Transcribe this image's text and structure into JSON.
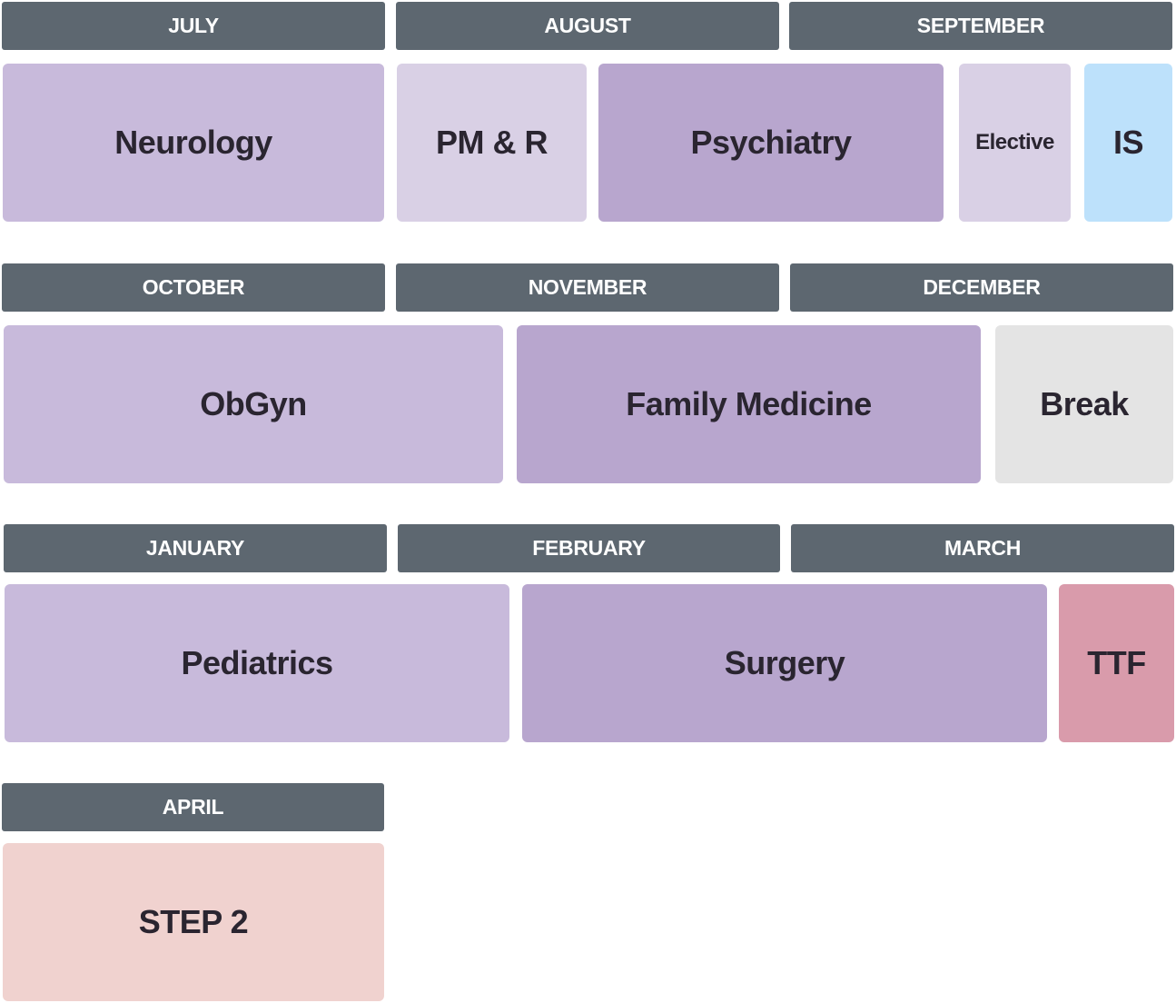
{
  "rows": [
    {
      "months": [
        "JULY",
        "AUGUST",
        "SEPTEMBER"
      ],
      "rotations": [
        {
          "label": "Neurology",
          "color": "#c8badb"
        },
        {
          "label": "PM & R",
          "color": "#d9d0e5"
        },
        {
          "label": "Psychiatry",
          "color": "#b8a6ce"
        },
        {
          "label": "Elective",
          "color": "#d9d0e5"
        },
        {
          "label": "IS",
          "color": "#bde1fb"
        }
      ]
    },
    {
      "months": [
        "OCTOBER",
        "NOVEMBER",
        "DECEMBER"
      ],
      "rotations": [
        {
          "label": "ObGyn",
          "color": "#c8badb"
        },
        {
          "label": "Family Medicine",
          "color": "#b8a6ce"
        },
        {
          "label": "Break",
          "color": "#e4e4e4"
        }
      ]
    },
    {
      "months": [
        "JANUARY",
        "FEBRUARY",
        "MARCH"
      ],
      "rotations": [
        {
          "label": "Pediatrics",
          "color": "#c8badb"
        },
        {
          "label": "Surgery",
          "color": "#b8a6ce"
        },
        {
          "label": "TTF",
          "color": "#d99bab"
        }
      ]
    },
    {
      "months": [
        "APRIL"
      ],
      "rotations": [
        {
          "label": "STEP 2",
          "color": "#f0d2cf"
        }
      ]
    }
  ],
  "colors": {
    "month_header": "#5d6770",
    "month_text": "#ffffff",
    "rotation_text": "#2a2530"
  }
}
